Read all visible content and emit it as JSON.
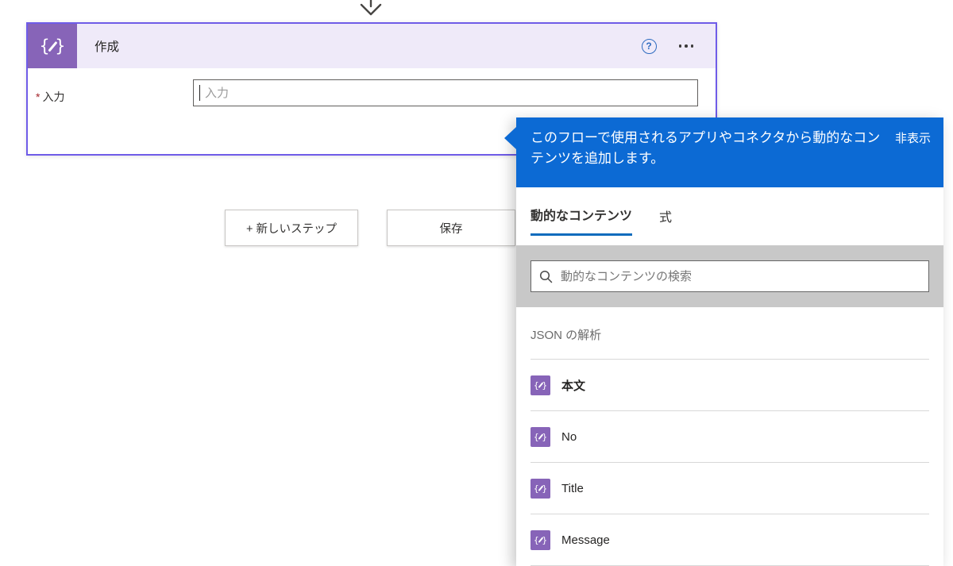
{
  "colors": {
    "action_purple": "#8764b8",
    "card_border": "#6f5ce8",
    "card_header_bg": "#efeaf9",
    "flyout_header_blue": "#0c6ad4",
    "tab_underline": "#0f6cbd",
    "required_red": "#a4262c",
    "search_strip_gray": "#c8c8c8"
  },
  "card": {
    "title": "作成",
    "required_marker": "*",
    "field_label": "入力",
    "input_value": "",
    "input_placeholder": "入力"
  },
  "buttons": {
    "new_step": "+ 新しいステップ",
    "save": "保存"
  },
  "flyout": {
    "message": "このフローで使用されるアプリやコネクタから動的なコンテンツを追加します。",
    "hide_button": "非表示",
    "tabs": [
      {
        "label": "動的なコンテンツ"
      },
      {
        "label": "式"
      }
    ],
    "search_placeholder": "動的なコンテンツの検索",
    "group_title": "JSON の解析",
    "items": [
      {
        "label": "本文"
      },
      {
        "label": "No"
      },
      {
        "label": "Title"
      },
      {
        "label": "Message"
      }
    ]
  }
}
